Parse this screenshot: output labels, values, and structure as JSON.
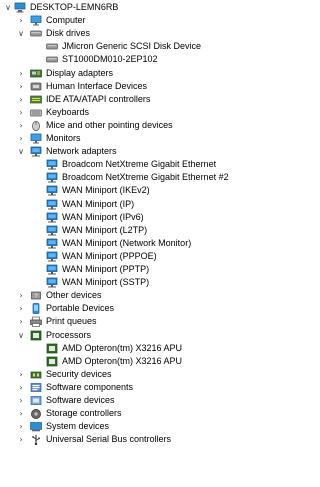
{
  "root": {
    "label": "DESKTOP-LEMN6RB",
    "icon": "computer-icon",
    "expanded": true
  },
  "categories": [
    {
      "label": "Computer",
      "icon": "monitor-icon",
      "expanded": false,
      "children": []
    },
    {
      "label": "Disk drives",
      "icon": "disk-drive-icon",
      "expanded": true,
      "children": [
        {
          "label": "JMicron Generic SCSI Disk Device",
          "icon": "disk-drive-icon"
        },
        {
          "label": "ST1000DM010-2EP102",
          "icon": "disk-drive-icon"
        }
      ]
    },
    {
      "label": "Display adapters",
      "icon": "display-adapter-icon",
      "expanded": false,
      "children": []
    },
    {
      "label": "Human Interface Devices",
      "icon": "hid-icon",
      "expanded": false,
      "children": []
    },
    {
      "label": "IDE ATA/ATAPI controllers",
      "icon": "ide-controller-icon",
      "expanded": false,
      "children": []
    },
    {
      "label": "Keyboards",
      "icon": "keyboard-icon",
      "expanded": false,
      "children": []
    },
    {
      "label": "Mice and other pointing devices",
      "icon": "mouse-icon",
      "expanded": false,
      "children": []
    },
    {
      "label": "Monitors",
      "icon": "monitor-icon",
      "expanded": false,
      "children": []
    },
    {
      "label": "Network adapters",
      "icon": "network-adapter-icon",
      "expanded": true,
      "children": [
        {
          "label": "Broadcom NetXtreme Gigabit Ethernet",
          "icon": "network-adapter-icon"
        },
        {
          "label": "Broadcom NetXtreme Gigabit Ethernet #2",
          "icon": "network-adapter-icon"
        },
        {
          "label": "WAN Miniport (IKEv2)",
          "icon": "network-adapter-icon"
        },
        {
          "label": "WAN Miniport (IP)",
          "icon": "network-adapter-icon"
        },
        {
          "label": "WAN Miniport (IPv6)",
          "icon": "network-adapter-icon"
        },
        {
          "label": "WAN Miniport (L2TP)",
          "icon": "network-adapter-icon"
        },
        {
          "label": "WAN Miniport (Network Monitor)",
          "icon": "network-adapter-icon"
        },
        {
          "label": "WAN Miniport (PPPOE)",
          "icon": "network-adapter-icon"
        },
        {
          "label": "WAN Miniport (PPTP)",
          "icon": "network-adapter-icon"
        },
        {
          "label": "WAN Miniport (SSTP)",
          "icon": "network-adapter-icon"
        }
      ]
    },
    {
      "label": "Other devices",
      "icon": "other-device-icon",
      "expanded": false,
      "children": []
    },
    {
      "label": "Portable Devices",
      "icon": "portable-device-icon",
      "expanded": false,
      "children": []
    },
    {
      "label": "Print queues",
      "icon": "printer-icon",
      "expanded": false,
      "children": []
    },
    {
      "label": "Processors",
      "icon": "processor-icon",
      "expanded": true,
      "children": [
        {
          "label": "AMD Opteron(tm) X3216 APU",
          "icon": "processor-icon"
        },
        {
          "label": "AMD Opteron(tm) X3216 APU",
          "icon": "processor-icon"
        }
      ]
    },
    {
      "label": "Security devices",
      "icon": "security-device-icon",
      "expanded": false,
      "children": []
    },
    {
      "label": "Software components",
      "icon": "software-component-icon",
      "expanded": false,
      "children": []
    },
    {
      "label": "Software devices",
      "icon": "software-device-icon",
      "expanded": false,
      "children": []
    },
    {
      "label": "Storage controllers",
      "icon": "storage-controller-icon",
      "expanded": false,
      "children": []
    },
    {
      "label": "System devices",
      "icon": "system-device-icon",
      "expanded": false,
      "children": []
    },
    {
      "label": "Universal Serial Bus controllers",
      "icon": "usb-icon",
      "expanded": false,
      "children": []
    }
  ],
  "colors": {
    "chevron": "#444444",
    "network_blue": "#1f7fd4",
    "processor_green": "#3f7a2a",
    "monitor_blue": "#2a8fd6"
  }
}
